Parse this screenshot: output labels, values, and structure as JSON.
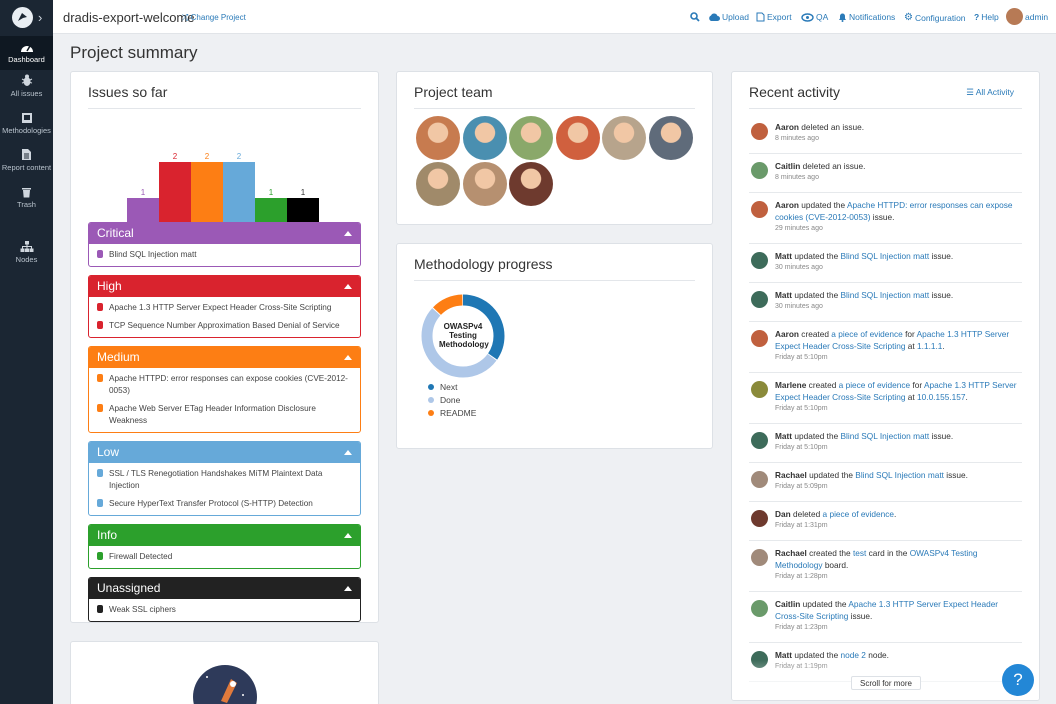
{
  "project": {
    "name": "dradis-export-welcome",
    "change_label": "Change Project"
  },
  "topnav": {
    "upload": "Upload",
    "export": "Export",
    "qa": "QA",
    "notifications": "Notifications",
    "configuration": "Configuration",
    "help": "Help",
    "user": "admin"
  },
  "sidebar": [
    {
      "label": "Dashboard",
      "icon": "dashboard-icon"
    },
    {
      "label": "All issues",
      "icon": "bug-icon"
    },
    {
      "label": "Methodologies",
      "icon": "book-icon"
    },
    {
      "label": "Report content",
      "icon": "document-icon"
    },
    {
      "label": "Trash",
      "icon": "trash-icon"
    },
    {
      "label": "Nodes",
      "icon": "network-icon"
    }
  ],
  "page_title": "Project summary",
  "issues_panel": {
    "title": "Issues so far",
    "chart_data": {
      "type": "bar",
      "categories": [
        "Critical",
        "High",
        "Medium",
        "Low",
        "Info",
        "N/A"
      ],
      "values": [
        1,
        2,
        2,
        2,
        1,
        1
      ],
      "colors": [
        "#9b59b6",
        "#d9232e",
        "#fd7e14",
        "#66a9d9",
        "#2ca02c",
        "#000000"
      ],
      "ylim": [
        0,
        2
      ]
    },
    "severities": [
      {
        "name": "Critical",
        "color": "#9b59b6",
        "items": [
          "Blind SQL Injection matt"
        ]
      },
      {
        "name": "High",
        "color": "#d9232e",
        "items": [
          "Apache 1.3 HTTP Server Expect Header Cross-Site Scripting",
          "TCP Sequence Number Approximation Based Denial of Service"
        ]
      },
      {
        "name": "Medium",
        "color": "#fd7e14",
        "items": [
          "Apache HTTPD: error responses can expose cookies (CVE-2012-0053)",
          "Apache Web Server ETag Header Information Disclosure Weakness"
        ]
      },
      {
        "name": "Low",
        "color": "#66a9d9",
        "items": [
          "SSL / TLS Renegotiation Handshakes MiTM Plaintext Data Injection",
          "Secure HyperText Transfer Protocol (S-HTTP) Detection"
        ]
      },
      {
        "name": "Info",
        "color": "#2ca02c",
        "items": [
          "Firewall Detected"
        ]
      },
      {
        "name": "Unassigned",
        "color": "#222222",
        "items": [
          "Weak SSL ciphers"
        ]
      }
    ]
  },
  "team_panel": {
    "title": "Project team",
    "members": [
      "#c77b4f",
      "#4a8fb0",
      "#8aa86a",
      "#d0603e",
      "#b7a48c",
      "#5f6b7a",
      "#a08a6a",
      "#b69070",
      "#6e3a2e"
    ]
  },
  "methodology_panel": {
    "title": "Methodology progress",
    "center_label": "OWASPv4 Testing Methodology",
    "chart_data": {
      "type": "pie",
      "categories": [
        "Next",
        "Done",
        "README"
      ],
      "values": [
        35,
        52,
        13
      ],
      "colors": [
        "#1f77b4",
        "#aec7e8",
        "#fd7e14"
      ]
    }
  },
  "activity_panel": {
    "title": "Recent activity",
    "all_label": "All Activity",
    "items": [
      {
        "user": "Aaron",
        "text": "deleted an issue.",
        "time": "8 minutes ago"
      },
      {
        "user": "Caitlin",
        "text": "deleted an issue.",
        "time": "8 minutes ago"
      },
      {
        "user": "Aaron",
        "text": "updated the Apache HTTPD: error responses can expose cookies (CVE-2012-0053) issue.",
        "time": "29 minutes ago"
      },
      {
        "user": "Matt",
        "text": "updated the Blind SQL Injection matt issue.",
        "time": "30 minutes ago"
      },
      {
        "user": "Matt",
        "text": "updated the Blind SQL Injection matt issue.",
        "time": "30 minutes ago"
      },
      {
        "user": "Aaron",
        "text": "created a piece of evidence for Apache 1.3 HTTP Server Expect Header Cross-Site Scripting at 1.1.1.1.",
        "time": "Friday at 5:10pm"
      },
      {
        "user": "Marlene",
        "text": "created a piece of evidence for Apache 1.3 HTTP Server Expect Header Cross-Site Scripting at 10.0.155.157.",
        "time": "Friday at 5:10pm"
      },
      {
        "user": "Matt",
        "text": "updated the Blind SQL Injection matt issue.",
        "time": "Friday at 5:10pm"
      },
      {
        "user": "Rachael",
        "text": "updated the Blind SQL Injection matt issue.",
        "time": "Friday at 5:09pm"
      },
      {
        "user": "Dan",
        "text": "deleted a piece of evidence.",
        "time": "Friday at 1:31pm"
      },
      {
        "user": "Rachael",
        "text": "created the test card in the OWASPv4 Testing Methodology board.",
        "time": "Friday at 1:28pm"
      },
      {
        "user": "Caitlin",
        "text": "updated the Apache 1.3 HTTP Server Expect Header Cross-Site Scripting issue.",
        "time": "Friday at 1:23pm"
      },
      {
        "user": "Matt",
        "text": "updated the node 2 node.",
        "time": "Friday at 1:19pm"
      }
    ],
    "scroll_label": "Scroll for more"
  },
  "help_label": "?"
}
